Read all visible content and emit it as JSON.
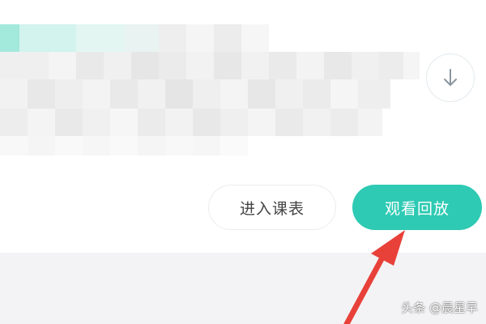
{
  "card": {
    "download_icon": "arrow-down-circle-icon",
    "blur_note": "pixelated-content"
  },
  "actions": {
    "schedule_label": "进入课表",
    "replay_label": "观看回放",
    "replay_color": "#2ecab3"
  },
  "annotation": {
    "arrow_color": "#e8413a"
  },
  "watermark": {
    "text": "头条 @晨星早"
  }
}
